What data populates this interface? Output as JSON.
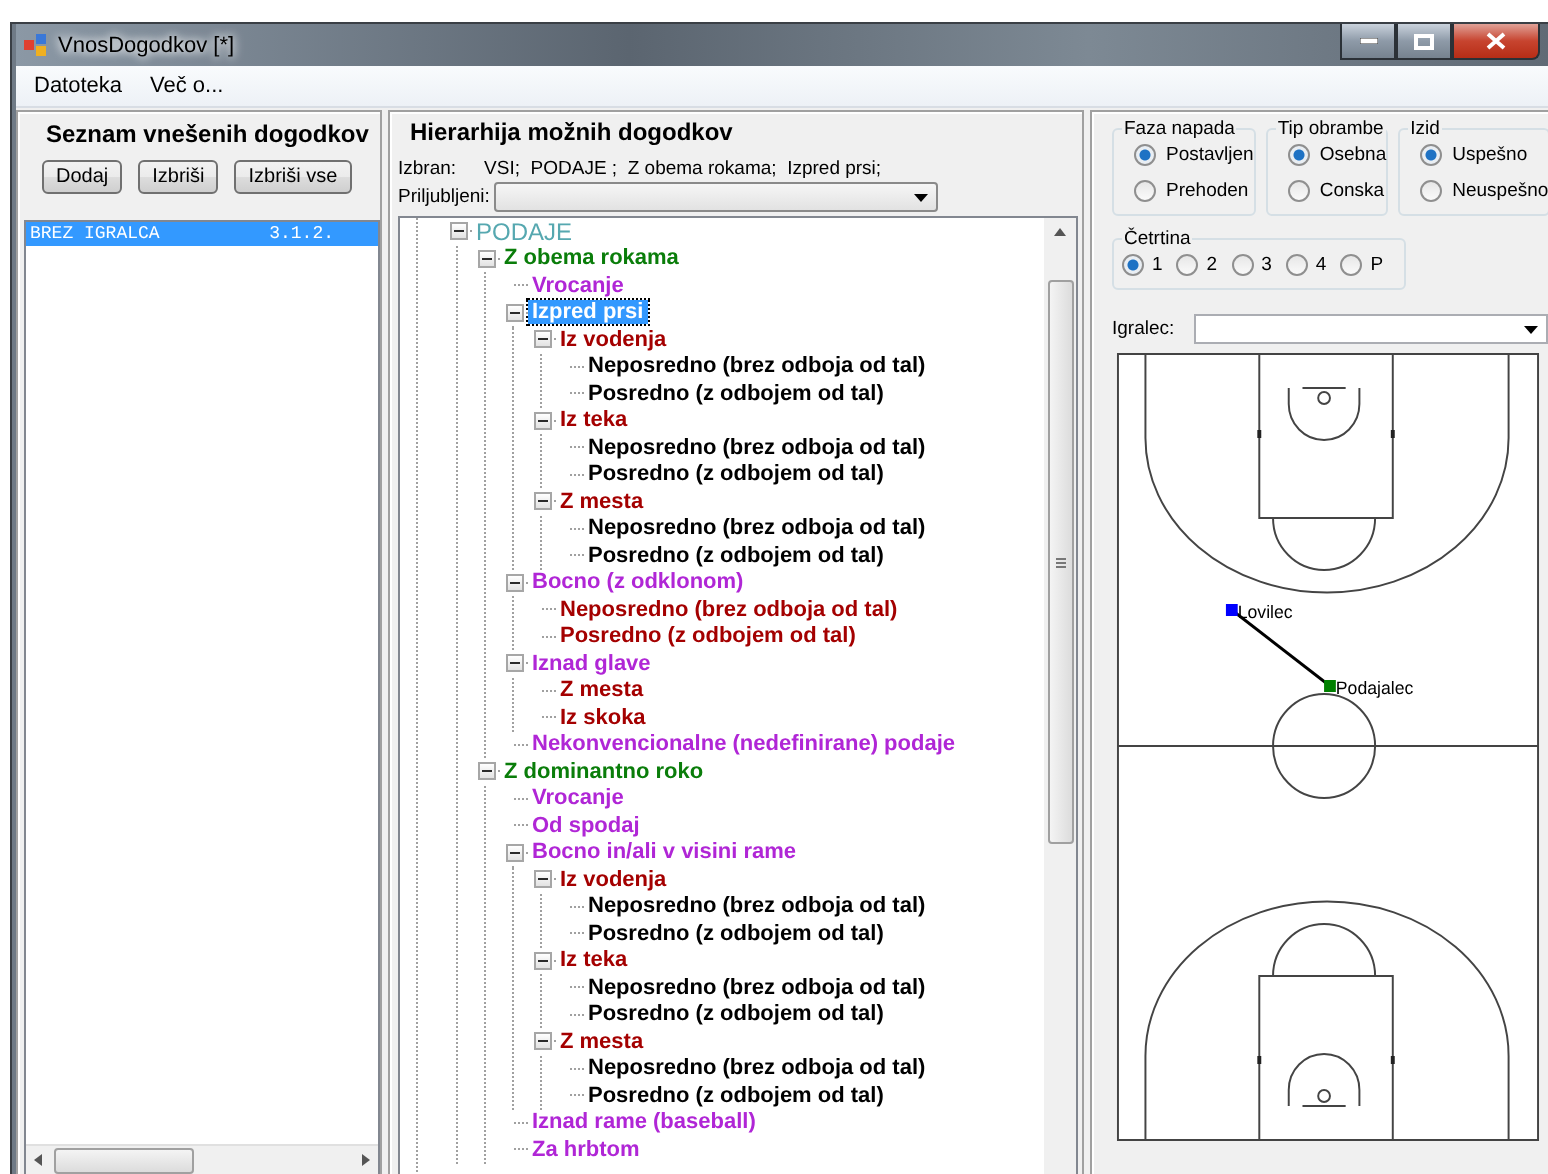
{
  "window": {
    "title": "VnosDogodkov [*]"
  },
  "menu": [
    "Datoteka",
    "Več o..."
  ],
  "events_panel": {
    "title": "Seznam vnešenih dogodkov",
    "buttons": [
      "Dodaj",
      "Izbriši",
      "Izbriši vse"
    ],
    "items": [
      {
        "name": "BREZ IGRALCA",
        "code": "3.1.2.",
        "selected": true
      }
    ]
  },
  "hierarchy_panel": {
    "title": "Hierarhija možnih dogodkov",
    "selected_label": "Izbran:",
    "selected_path": "VSI;  PODAJE ;  Z obema rokama;  Izpred prsi;",
    "favorites_label": "Priljubljeni:",
    "tree": [
      {
        "label": "PODAJE",
        "selected": false,
        "expanded": true,
        "children": [
          {
            "label": "Z obema rokama",
            "selected": false,
            "expanded": true,
            "children": [
              {
                "label": "Vrocanje",
                "selected": false
              },
              {
                "label": "Izpred prsi",
                "selected": true,
                "expanded": true,
                "children": [
                  {
                    "label": "Iz vodenja",
                    "selected": false,
                    "expanded": true,
                    "children": [
                      {
                        "label": "Neposredno (brez odboja od tal)",
                        "selected": false
                      },
                      {
                        "label": "Posredno (z odbojem od tal)",
                        "selected": false
                      }
                    ]
                  },
                  {
                    "label": "Iz teka",
                    "selected": false,
                    "expanded": true,
                    "children": [
                      {
                        "label": "Neposredno (brez odboja od tal)",
                        "selected": false
                      },
                      {
                        "label": "Posredno (z odbojem od tal)",
                        "selected": false
                      }
                    ]
                  },
                  {
                    "label": "Z mesta",
                    "selected": false,
                    "expanded": true,
                    "children": [
                      {
                        "label": "Neposredno (brez odboja od tal)",
                        "selected": false
                      },
                      {
                        "label": "Posredno (z odbojem od tal)",
                        "selected": false
                      }
                    ]
                  }
                ]
              },
              {
                "label": "Bocno (z odklonom)",
                "selected": false,
                "expanded": true,
                "children": [
                  {
                    "label": "Neposredno (brez odboja od tal)",
                    "selected": false
                  },
                  {
                    "label": "Posredno (z odbojem od tal)",
                    "selected": false
                  }
                ]
              },
              {
                "label": "Iznad glave",
                "selected": false,
                "expanded": true,
                "children": [
                  {
                    "label": "Z mesta",
                    "selected": false
                  },
                  {
                    "label": "Iz skoka",
                    "selected": false
                  }
                ]
              },
              {
                "label": "Nekonvencionalne (nedefinirane) podaje",
                "selected": false
              }
            ]
          },
          {
            "label": "Z dominantno roko",
            "selected": false,
            "expanded": true,
            "children": [
              {
                "label": "Vrocanje",
                "selected": false
              },
              {
                "label": "Od spodaj",
                "selected": false
              },
              {
                "label": "Bocno in/ali v visini rame",
                "selected": false,
                "expanded": true,
                "children": [
                  {
                    "label": "Iz vodenja",
                    "selected": false,
                    "expanded": true,
                    "children": [
                      {
                        "label": "Neposredno (brez odboja od tal)",
                        "selected": false
                      },
                      {
                        "label": "Posredno (z odbojem od tal)",
                        "selected": false
                      }
                    ]
                  },
                  {
                    "label": "Iz teka",
                    "selected": false,
                    "expanded": true,
                    "children": [
                      {
                        "label": "Neposredno (brez odboja od tal)",
                        "selected": false
                      },
                      {
                        "label": "Posredno (z odbojem od tal)",
                        "selected": false
                      }
                    ]
                  },
                  {
                    "label": "Z mesta",
                    "selected": false,
                    "expanded": true,
                    "children": [
                      {
                        "label": "Neposredno (brez odboja od tal)",
                        "selected": false
                      },
                      {
                        "label": "Posredno (z odbojem od tal)",
                        "selected": false
                      }
                    ]
                  }
                ]
              },
              {
                "label": "Iznad rame (baseball)",
                "selected": false
              },
              {
                "label": "Za hrbtom",
                "selected": false
              }
            ]
          }
        ]
      }
    ]
  },
  "filters": {
    "groups": [
      {
        "title": "Faza napada",
        "options": [
          {
            "label": "Postavljen",
            "selected": true
          },
          {
            "label": "Prehoden",
            "selected": false
          }
        ]
      },
      {
        "title": "Tip obrambe",
        "options": [
          {
            "label": "Osebna",
            "selected": true
          },
          {
            "label": "Conska",
            "selected": false
          }
        ]
      },
      {
        "title": "Izid",
        "options": [
          {
            "label": "Uspešno",
            "selected": true
          },
          {
            "label": "Neuspešno",
            "selected": false
          }
        ]
      }
    ],
    "quarter": {
      "title": "Četrtina",
      "options": [
        {
          "label": "1",
          "selected": true
        },
        {
          "label": "2",
          "selected": false
        },
        {
          "label": "3",
          "selected": false
        },
        {
          "label": "4",
          "selected": false
        },
        {
          "label": "P",
          "selected": false
        }
      ]
    },
    "player_label": "Igralec:"
  },
  "court": {
    "players": [
      {
        "label": "Lovilec",
        "color": "#0000ff"
      },
      {
        "label": "Podajalec",
        "color": "#008000"
      }
    ]
  }
}
